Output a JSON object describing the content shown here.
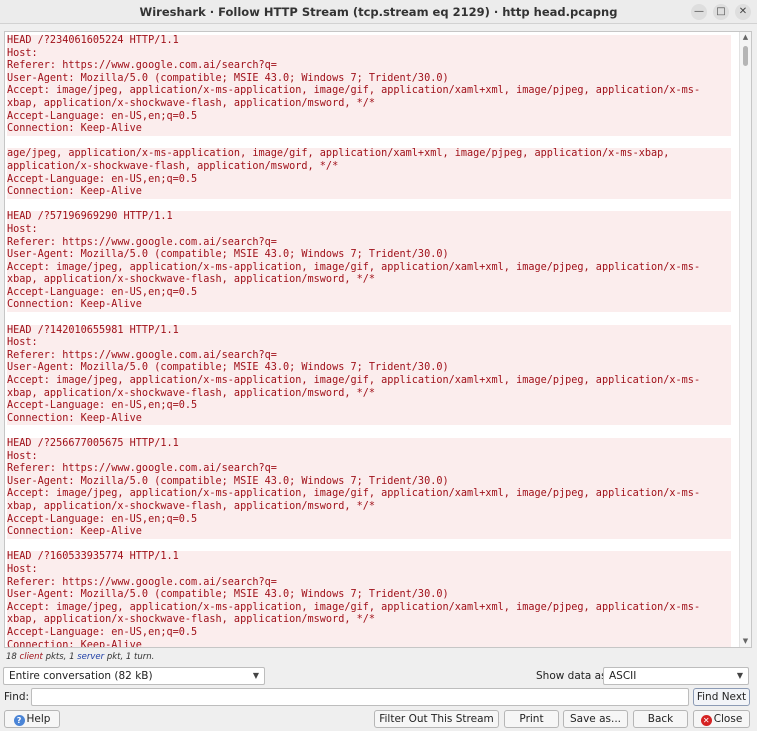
{
  "window": {
    "title": "Wireshark · Follow HTTP Stream (tcp.stream eq 2129) · http head.pcapng",
    "minimize_icon": "minimize-icon",
    "maximize_icon": "maximize-icon",
    "close_icon": "close-icon"
  },
  "stream": {
    "lines": [
      {
        "text": "HEAD /?234061605224 HTTP/1.1",
        "type": "client"
      },
      {
        "text": "Host:",
        "type": "client"
      },
      {
        "text": "Referer: https://www.google.com.ai/search?q=",
        "type": "client"
      },
      {
        "text": "User-Agent: Mozilla/5.0 (compatible; MSIE 43.0; Windows 7; Trident/30.0)",
        "type": "client"
      },
      {
        "text": "Accept: image/jpeg, application/x-ms-application, image/gif, application/xaml+xml, image/pjpeg, application/x-ms-",
        "type": "client"
      },
      {
        "text": "xbap, application/x-shockwave-flash, application/msword, */*",
        "type": "client"
      },
      {
        "text": "Accept-Language: en-US,en;q=0.5",
        "type": "client"
      },
      {
        "text": "Connection: Keep-Alive",
        "type": "client"
      },
      {
        "text": "",
        "type": "blank"
      },
      {
        "text": "age/jpeg, application/x-ms-application, image/gif, application/xaml+xml, image/pjpeg, application/x-ms-xbap,",
        "type": "client"
      },
      {
        "text": "application/x-shockwave-flash, application/msword, */*",
        "type": "client"
      },
      {
        "text": "Accept-Language: en-US,en;q=0.5",
        "type": "client"
      },
      {
        "text": "Connection: Keep-Alive",
        "type": "client"
      },
      {
        "text": "",
        "type": "blank"
      },
      {
        "text": "HEAD /?57196969290 HTTP/1.1",
        "type": "client"
      },
      {
        "text": "Host:",
        "type": "client"
      },
      {
        "text": "Referer: https://www.google.com.ai/search?q=",
        "type": "client"
      },
      {
        "text": "User-Agent: Mozilla/5.0 (compatible; MSIE 43.0; Windows 7; Trident/30.0)",
        "type": "client"
      },
      {
        "text": "Accept: image/jpeg, application/x-ms-application, image/gif, application/xaml+xml, image/pjpeg, application/x-ms-",
        "type": "client"
      },
      {
        "text": "xbap, application/x-shockwave-flash, application/msword, */*",
        "type": "client"
      },
      {
        "text": "Accept-Language: en-US,en;q=0.5",
        "type": "client"
      },
      {
        "text": "Connection: Keep-Alive",
        "type": "client"
      },
      {
        "text": "",
        "type": "blank"
      },
      {
        "text": "HEAD /?142010655981 HTTP/1.1",
        "type": "client"
      },
      {
        "text": "Host:",
        "type": "client"
      },
      {
        "text": "Referer: https://www.google.com.ai/search?q=",
        "type": "client"
      },
      {
        "text": "User-Agent: Mozilla/5.0 (compatible; MSIE 43.0; Windows 7; Trident/30.0)",
        "type": "client"
      },
      {
        "text": "Accept: image/jpeg, application/x-ms-application, image/gif, application/xaml+xml, image/pjpeg, application/x-ms-",
        "type": "client"
      },
      {
        "text": "xbap, application/x-shockwave-flash, application/msword, */*",
        "type": "client"
      },
      {
        "text": "Accept-Language: en-US,en;q=0.5",
        "type": "client"
      },
      {
        "text": "Connection: Keep-Alive",
        "type": "client"
      },
      {
        "text": "",
        "type": "blank"
      },
      {
        "text": "HEAD /?256677005675 HTTP/1.1",
        "type": "client"
      },
      {
        "text": "Host:",
        "type": "client"
      },
      {
        "text": "Referer: https://www.google.com.ai/search?q=",
        "type": "client"
      },
      {
        "text": "User-Agent: Mozilla/5.0 (compatible; MSIE 43.0; Windows 7; Trident/30.0)",
        "type": "client"
      },
      {
        "text": "Accept: image/jpeg, application/x-ms-application, image/gif, application/xaml+xml, image/pjpeg, application/x-ms-",
        "type": "client"
      },
      {
        "text": "xbap, application/x-shockwave-flash, application/msword, */*",
        "type": "client"
      },
      {
        "text": "Accept-Language: en-US,en;q=0.5",
        "type": "client"
      },
      {
        "text": "Connection: Keep-Alive",
        "type": "client"
      },
      {
        "text": "",
        "type": "blank"
      },
      {
        "text": "HEAD /?160533935774 HTTP/1.1",
        "type": "client"
      },
      {
        "text": "Host:",
        "type": "client"
      },
      {
        "text": "Referer: https://www.google.com.ai/search?q=",
        "type": "client"
      },
      {
        "text": "User-Agent: Mozilla/5.0 (compatible; MSIE 43.0; Windows 7; Trident/30.0)",
        "type": "client"
      },
      {
        "text": "Accept: image/jpeg, application/x-ms-application, image/gif, application/xaml+xml, image/pjpeg, application/x-ms-",
        "type": "client"
      },
      {
        "text": "xbap, application/x-shockwave-flash, application/msword, */*",
        "type": "client"
      },
      {
        "text": "Accept-Language: en-US,en;q=0.5",
        "type": "client"
      },
      {
        "text": "Connection: Keep-Alive",
        "type": "client"
      }
    ]
  },
  "status": {
    "client_count": "18",
    "client_word": "client",
    "pkts_sep": " pkts, ",
    "server_count": "1",
    "server_word": "server",
    "tail": " pkt, 1 turn."
  },
  "controls": {
    "conversation_value": "Entire conversation (82 kB)",
    "show_label": "Show data as",
    "show_value": "ASCII",
    "find_label": "Find:",
    "find_value": "",
    "find_next_label": "Find Next"
  },
  "buttons": {
    "help": "Help",
    "filter_out": "Filter Out This Stream",
    "print": "Print",
    "save_as": "Save as...",
    "back": "Back",
    "close": "Close"
  },
  "colors": {
    "client_text": "#a0111a",
    "client_bg": "#fbeded",
    "server_text": "#1f3fa6"
  }
}
